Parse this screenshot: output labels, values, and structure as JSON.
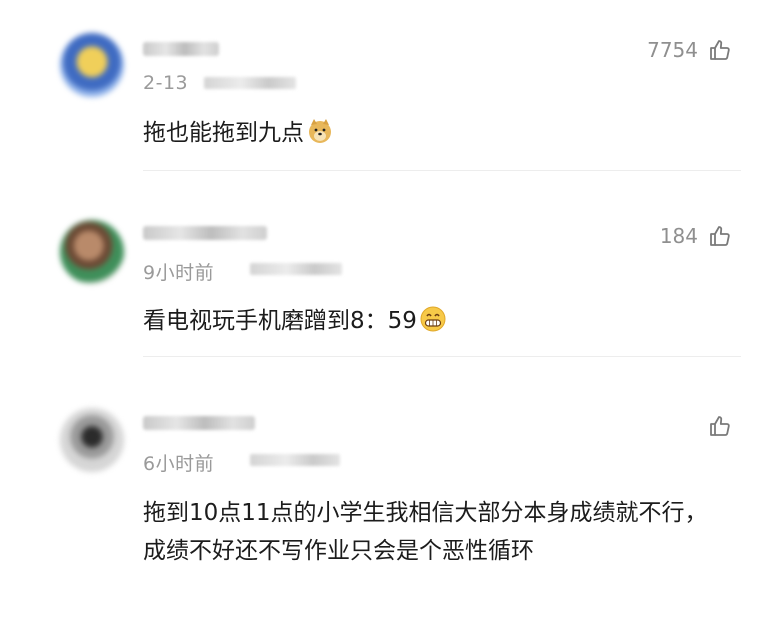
{
  "comments": [
    {
      "date": "2-13",
      "likes": "7754",
      "text": "拖也能拖到九点",
      "emoji": "doge-emoji"
    },
    {
      "date": "9小时前",
      "likes": "184",
      "text": "看电视玩手机磨蹭到8：59",
      "emoji": "grin-emoji"
    },
    {
      "date": "6小时前",
      "likes": "",
      "text": "拖到10点11点的小学生我相信大部分本身成绩就不行，成绩不好还不写作业只会是个恶性循环"
    }
  ],
  "icons": {
    "like": "thumbs-up-outline-icon"
  },
  "colors": {
    "text_primary": "#1c1c1c",
    "text_secondary": "#9a9a9a",
    "divider": "#ededed"
  }
}
